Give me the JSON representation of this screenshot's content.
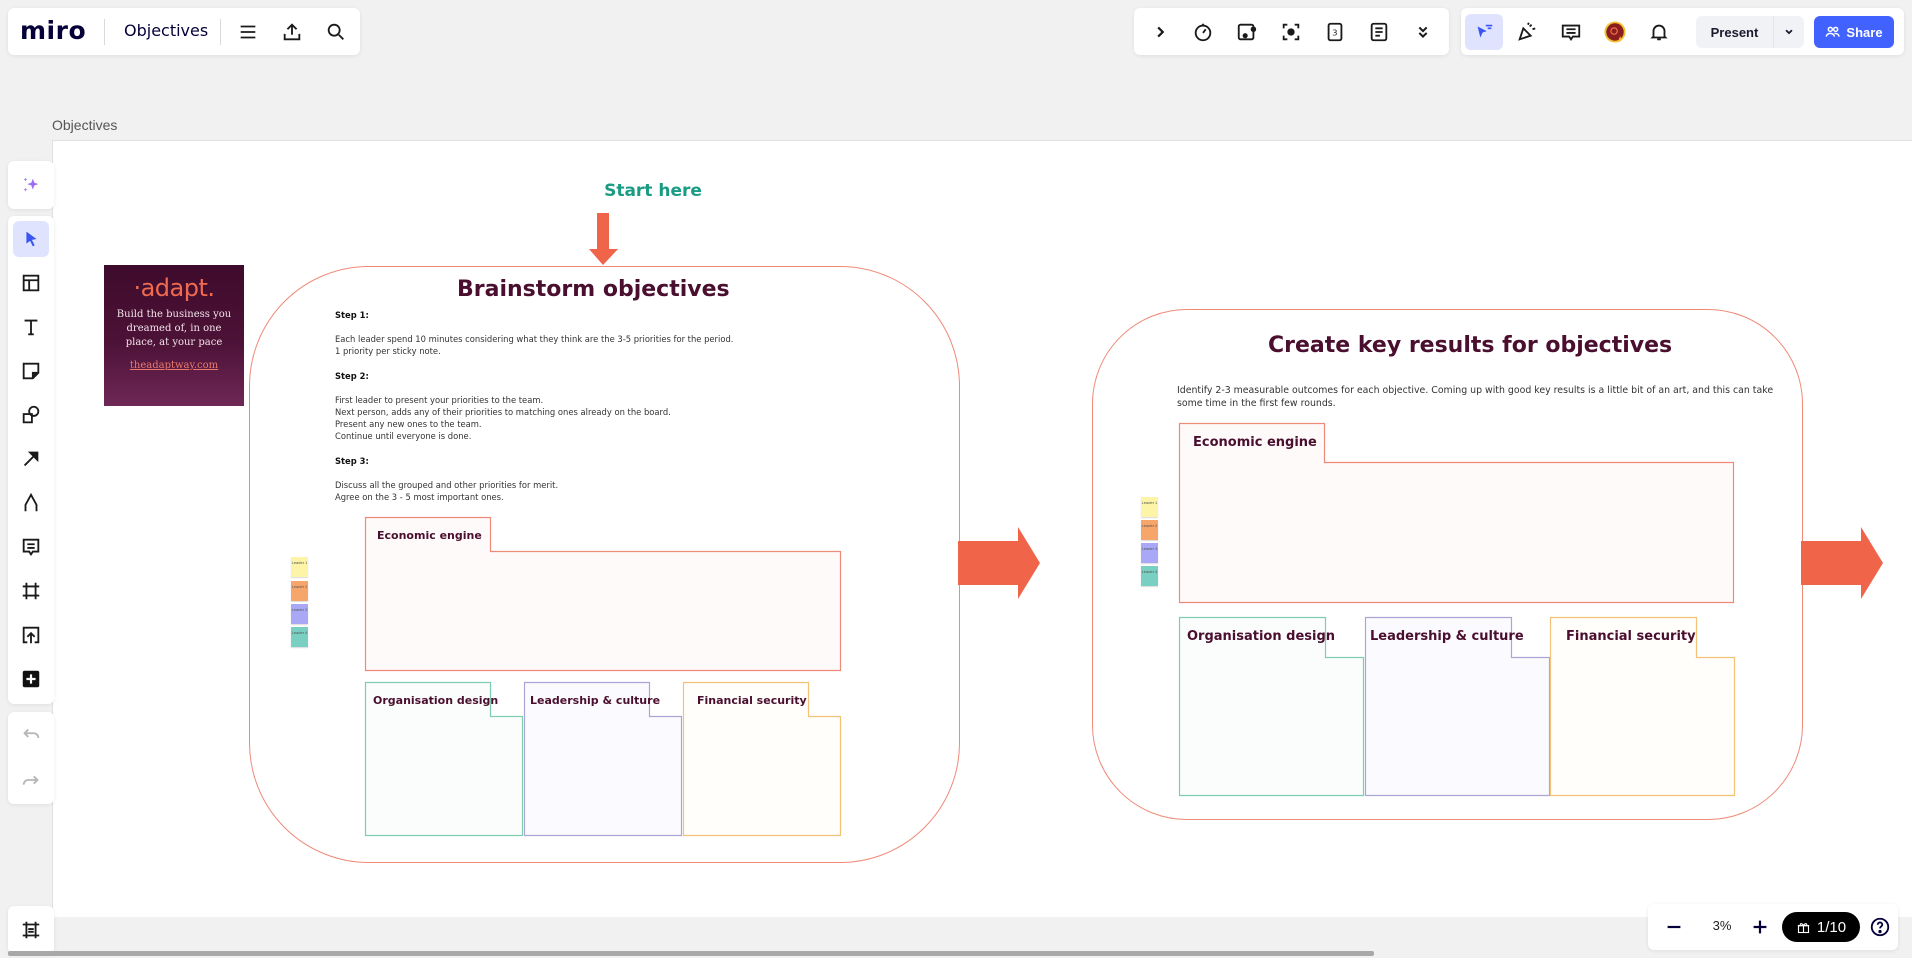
{
  "topbar": {
    "logo": "miro",
    "board_title": "Objectives",
    "icons": [
      "menu-icon",
      "export-icon",
      "search-icon"
    ]
  },
  "tools_bar": {
    "icons": [
      "expand-icon",
      "timer-icon",
      "voting-icon",
      "focus-icon",
      "card-icon",
      "notes-icon",
      "more-icon"
    ]
  },
  "collab_bar": {
    "present_label": "Present",
    "share_label": "Share"
  },
  "frame_label": "Objectives",
  "left_toolbar": {
    "items": [
      "select",
      "templates",
      "text",
      "sticky-note",
      "shapes",
      "connection-line",
      "pen",
      "comment",
      "frame",
      "upload",
      "more-apps"
    ]
  },
  "zoom": {
    "level": "3%",
    "page_counter": "1/10"
  },
  "board": {
    "start_here": "Start here",
    "adapt_card": {
      "logo": "·adapt.",
      "tagline": "Build the business you dreamed of, in one place, at your pace",
      "link": "theadaptway.com"
    },
    "brainstorm": {
      "title": "Brainstorm objectives",
      "step1_label": "Step 1:",
      "step1_lines": [
        "Each leader spend 10 minutes considering what they think are the 3-5 priorities for the period.",
        "1 priority per sticky note."
      ],
      "step2_label": "Step 2:",
      "step2_lines": [
        "First leader to present your priorities to the team.",
        "Next person, adds any of their priorities to matching ones already on the board.",
        "Present any new ones to the team.",
        "Continue until everyone is done."
      ],
      "step3_label": "Step 3:",
      "step3_lines": [
        "Discuss all the grouped and other priorities for merit.",
        "Agree on the 3 - 5 most important ones."
      ],
      "boxes": [
        "Economic engine",
        "Organisation design",
        "Leadership & culture",
        "Financial security"
      ],
      "stickies": [
        "Leader 1",
        "Leader 2",
        "Leader 3",
        "Leader 4"
      ]
    },
    "key_results": {
      "title": "Create key results for objectives",
      "description": "Identify 2-3 measurable outcomes for each objective. Coming up with good key results is a little bit of an art, and this can take some time in the first few rounds.",
      "boxes": [
        "Economic engine",
        "Organisation design",
        "Leadership & culture",
        "Financial security"
      ],
      "stickies": [
        "Leader 1",
        "Leader 2",
        "Leader 3",
        "Leader 4"
      ]
    },
    "colors": {
      "economic": "#f08a78",
      "organisation": "#7fcdb0",
      "leadership": "#a9a6d6",
      "financial": "#f3c278",
      "arrow": "#f0644a",
      "title": "#4a0e2e",
      "start_here": "#1a9b83",
      "sticky_yellow": "#fdf4a8",
      "sticky_orange": "#f7a66b",
      "sticky_violet": "#a8a8f6",
      "sticky_teal": "#79cfc1"
    }
  }
}
